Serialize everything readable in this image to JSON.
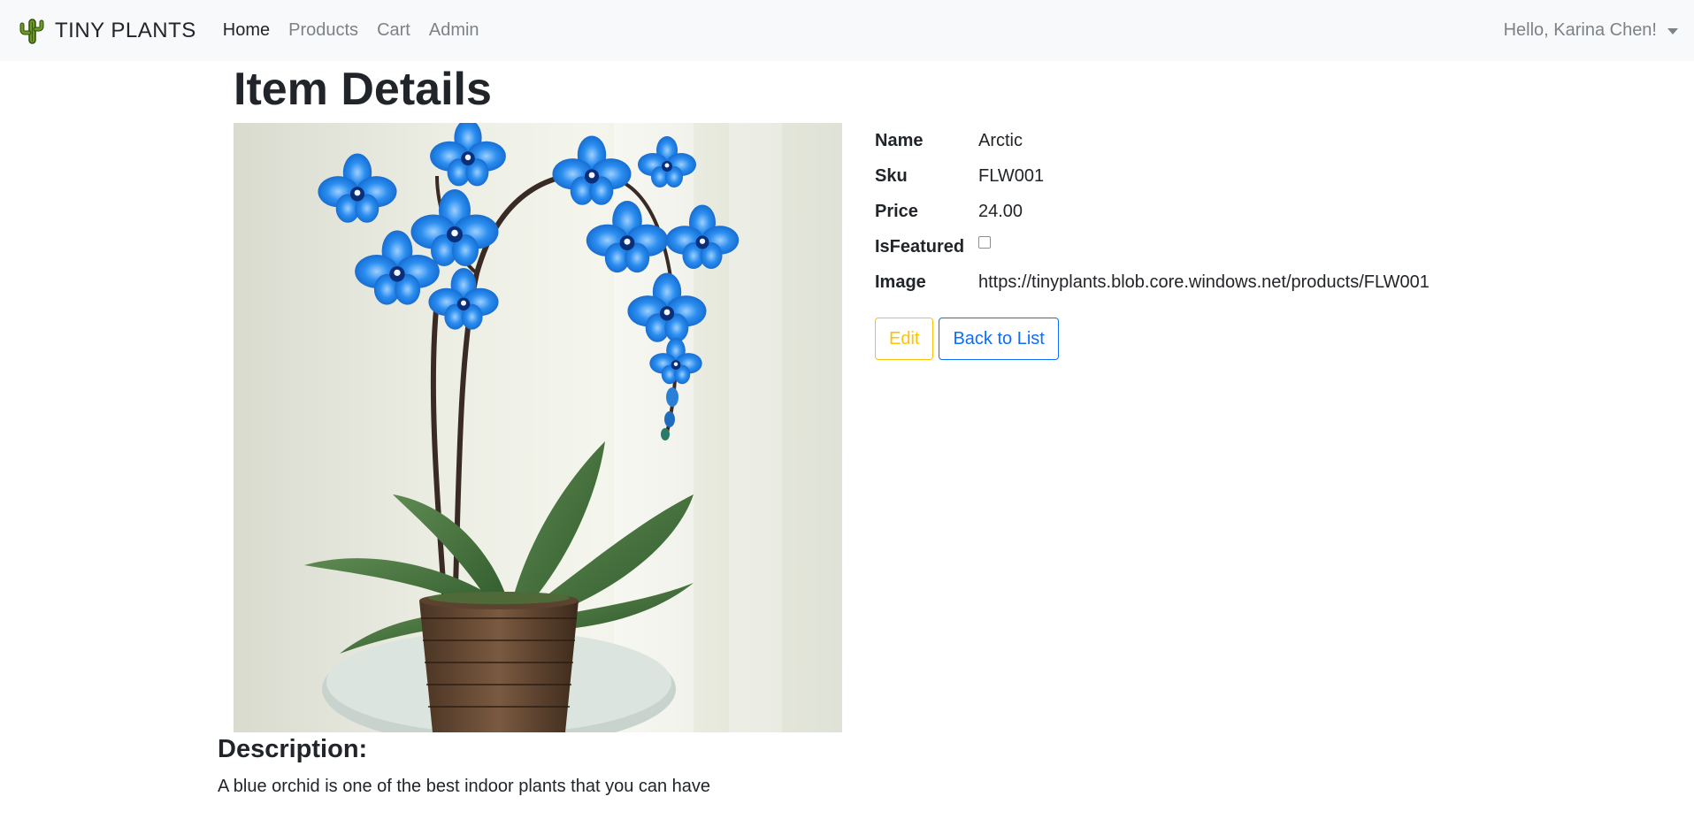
{
  "navbar": {
    "brand": "TINY PLANTS",
    "brand_icon": "cactus-icon",
    "links": [
      {
        "label": "Home",
        "active": true
      },
      {
        "label": "Products",
        "active": false
      },
      {
        "label": "Cart",
        "active": false
      },
      {
        "label": "Admin",
        "active": false
      }
    ],
    "user_greeting": "Hello, Karina Chen!"
  },
  "page": {
    "title": "Item Details"
  },
  "product": {
    "image_subject": "blue orchid in woven basket pot",
    "fields": [
      {
        "label": "Name",
        "value": "Arctic"
      },
      {
        "label": "Sku",
        "value": "FLW001"
      },
      {
        "label": "Price",
        "value": "24.00"
      },
      {
        "label": "IsFeatured",
        "value": false
      },
      {
        "label": "Image",
        "value": "https://tinyplants.blob.core.windows.net/products/FLW001"
      }
    ]
  },
  "actions": {
    "edit_label": "Edit",
    "back_label": "Back to List"
  },
  "description": {
    "heading": "Description:",
    "text": "A blue orchid is one of the best indoor plants that you can have"
  },
  "colors": {
    "navbar_bg": "#f8f9fa",
    "nav_muted": "#7d8287",
    "edit_accent": "#ffc107",
    "back_accent": "#0d6efd",
    "orchid_blue": "#1e7be0"
  }
}
